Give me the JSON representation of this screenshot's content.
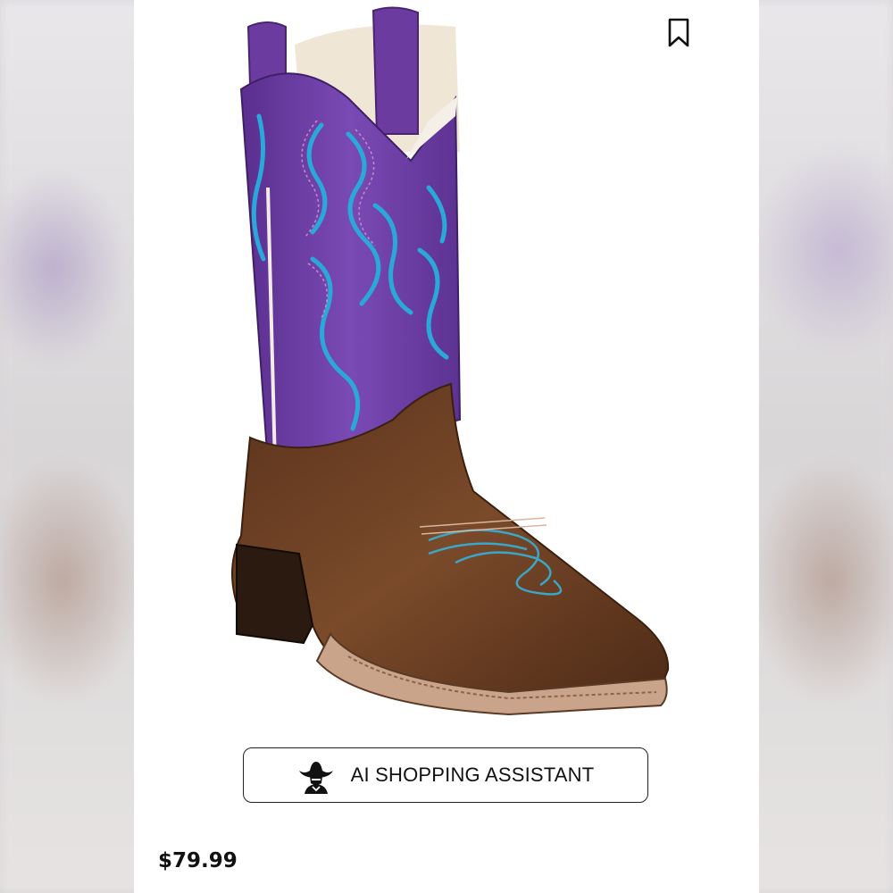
{
  "product": {
    "image_name": "cowboy-boot-photo",
    "price": "$79.99"
  },
  "actions": {
    "bookmark_icon": "bookmark-icon",
    "ai_assistant_label": "AI SHOPPING ASSISTANT",
    "ai_assistant_icon": "cowboy-icon"
  },
  "colors": {
    "boot_shaft": "#6a3ea0",
    "boot_foot": "#6e4226",
    "stitch": "#2aa8d8",
    "text": "#111111"
  }
}
